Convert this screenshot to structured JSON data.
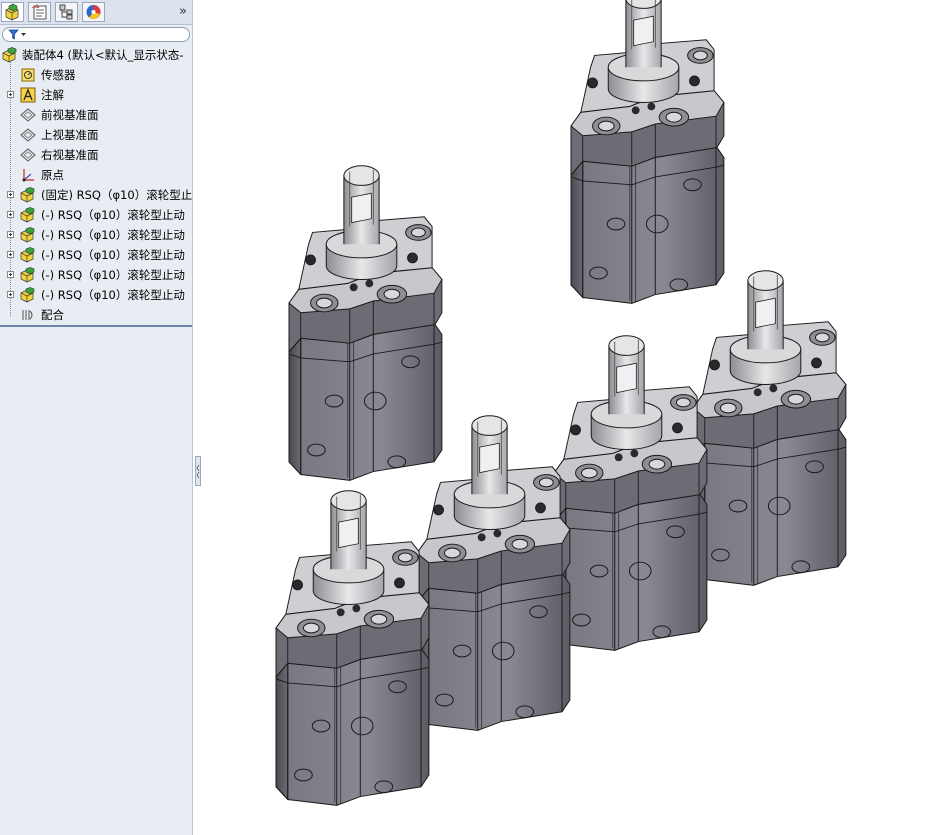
{
  "tabs": [
    {
      "name": "featuremanager-tab",
      "icon": "assembly-icon"
    },
    {
      "name": "propertymanager-tab",
      "icon": "property-icon"
    },
    {
      "name": "configurationmanager-tab",
      "icon": "configuration-icon"
    },
    {
      "name": "displaymanager-tab",
      "icon": "appearance-icon"
    }
  ],
  "more_label": "»",
  "tree": {
    "root": "装配体4  (默认<默认_显示状态-",
    "items": [
      {
        "label": "传感器",
        "icon": "sensor-icon",
        "expandable": false
      },
      {
        "label": "注解",
        "icon": "annotation-icon",
        "expandable": true
      },
      {
        "label": "前视基准面",
        "icon": "plane-icon",
        "expandable": false
      },
      {
        "label": "上视基准面",
        "icon": "plane-icon",
        "expandable": false
      },
      {
        "label": "右视基准面",
        "icon": "plane-icon",
        "expandable": false
      },
      {
        "label": "原点",
        "icon": "origin-icon",
        "expandable": false
      },
      {
        "label": "(固定) RSQ（φ10）滚轮型止",
        "icon": "part-icon",
        "expandable": true
      },
      {
        "label": "(-) RSQ（φ10）滚轮型止动",
        "icon": "part-icon",
        "expandable": true
      },
      {
        "label": "(-) RSQ（φ10）滚轮型止动",
        "icon": "part-icon",
        "expandable": true
      },
      {
        "label": "(-) RSQ（φ10）滚轮型止动",
        "icon": "part-icon",
        "expandable": true
      },
      {
        "label": "(-) RSQ（φ10）滚轮型止动",
        "icon": "part-icon",
        "expandable": true
      },
      {
        "label": "(-) RSQ（φ10）滚轮型止动",
        "icon": "part-icon",
        "expandable": true
      },
      {
        "label": "配合",
        "icon": "mates-icon",
        "expandable": false
      }
    ]
  },
  "colors": {
    "body": "#6f6d74",
    "body_dark": "#4e4c54",
    "top": "#c9c9cd",
    "edge": "#1a1a1a",
    "panel": "#e8ecf3"
  }
}
